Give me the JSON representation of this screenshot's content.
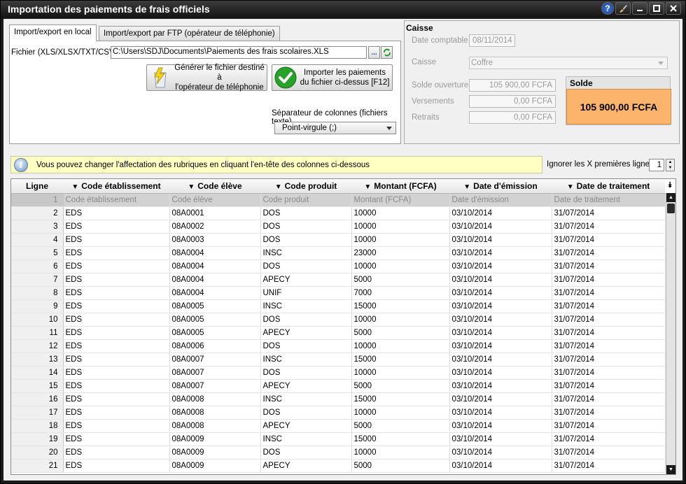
{
  "window": {
    "title": "Importation des paiements de frais officiels",
    "icons": [
      "help-icon",
      "brush-icon",
      "minimize-icon",
      "maximize-icon",
      "close-icon"
    ]
  },
  "tabs": [
    {
      "label": "Import/export en local",
      "active": true
    },
    {
      "label": "Import/export par FTP (opérateur de téléphonie)",
      "active": false
    }
  ],
  "local": {
    "file_label": "Fichier (XLS/XLSX/TXT/CSV)",
    "file_value": "C:\\Users\\SDJ\\Documents\\Paiements des frais scolaires.XLS",
    "browse_label": "...",
    "generate_label": "Générer le fichier destiné à\nl'opérateur de téléphonie",
    "import_label": "Importer les paiements\ndu fichier ci-dessus [F12]",
    "separator_label": "Séparateur de colonnes (fichiers texte)",
    "separator_value": "Point-virgule (;)"
  },
  "caisse": {
    "title": "Caisse",
    "date_label": "Date comptable",
    "date_value": "08/11/2014",
    "caisse_label": "Caisse",
    "caisse_value": "Coffre",
    "solde_ouverture_label": "Solde ouverture",
    "solde_ouverture_value": "105 900,00 FCFA",
    "versements_label": "Versements",
    "versements_value": "0,00 FCFA",
    "retraits_label": "Retraits",
    "retraits_value": "0,00 FCFA",
    "solde_label": "Solde",
    "solde_value": "105 900,00 FCFA",
    "solde_color": "#fcb36b"
  },
  "info": {
    "text": "Vous pouvez changer l'affectation des rubriques en cliquant l'en-tête des colonnes ci-dessous",
    "ignore_label": "Ignorer les X premières lignes",
    "ignore_value": "1"
  },
  "grid": {
    "headers": [
      "Ligne",
      "Code établissement",
      "Code élève",
      "Code produit",
      "Montant (FCFA)",
      "Date d'émission",
      "Date de traitement"
    ],
    "rows": [
      [
        "1",
        "Code établissement",
        "Code élève",
        "Code produit",
        "Montant (FCFA)",
        "Date d'émission",
        "Date de traitement"
      ],
      [
        "2",
        "EDS",
        "08A0001",
        "DOS",
        "10000",
        "03/10/2014",
        "31/07/2014"
      ],
      [
        "3",
        "EDS",
        "08A0002",
        "DOS",
        "10000",
        "03/10/2014",
        "31/07/2014"
      ],
      [
        "4",
        "EDS",
        "08A0003",
        "DOS",
        "10000",
        "03/10/2014",
        "31/07/2014"
      ],
      [
        "5",
        "EDS",
        "08A0004",
        "INSC",
        "23000",
        "03/10/2014",
        "31/07/2014"
      ],
      [
        "6",
        "EDS",
        "08A0004",
        "DOS",
        "10000",
        "03/10/2014",
        "31/07/2014"
      ],
      [
        "7",
        "EDS",
        "08A0004",
        "APECY",
        "5000",
        "03/10/2014",
        "31/07/2014"
      ],
      [
        "8",
        "EDS",
        "08A0004",
        "UNIF",
        "7000",
        "03/10/2014",
        "31/07/2014"
      ],
      [
        "9",
        "EDS",
        "08A0005",
        "INSC",
        "15000",
        "03/10/2014",
        "31/07/2014"
      ],
      [
        "10",
        "EDS",
        "08A0005",
        "DOS",
        "10000",
        "03/10/2014",
        "31/07/2014"
      ],
      [
        "11",
        "EDS",
        "08A0005",
        "APECY",
        "5000",
        "03/10/2014",
        "31/07/2014"
      ],
      [
        "12",
        "EDS",
        "08A0006",
        "DOS",
        "10000",
        "03/10/2014",
        "31/07/2014"
      ],
      [
        "13",
        "EDS",
        "08A0007",
        "INSC",
        "15000",
        "03/10/2014",
        "31/07/2014"
      ],
      [
        "14",
        "EDS",
        "08A0007",
        "DOS",
        "10000",
        "03/10/2014",
        "31/07/2014"
      ],
      [
        "15",
        "EDS",
        "08A0007",
        "APECY",
        "5000",
        "03/10/2014",
        "31/07/2014"
      ],
      [
        "16",
        "EDS",
        "08A0008",
        "INSC",
        "15000",
        "03/10/2014",
        "31/07/2014"
      ],
      [
        "17",
        "EDS",
        "08A0008",
        "DOS",
        "10000",
        "03/10/2014",
        "31/07/2014"
      ],
      [
        "18",
        "EDS",
        "08A0008",
        "APECY",
        "5000",
        "03/10/2014",
        "31/07/2014"
      ],
      [
        "19",
        "EDS",
        "08A0009",
        "INSC",
        "15000",
        "03/10/2014",
        "31/07/2014"
      ],
      [
        "20",
        "EDS",
        "08A0009",
        "DOS",
        "10000",
        "03/10/2014",
        "31/07/2014"
      ],
      [
        "21",
        "EDS",
        "08A0009",
        "APECY",
        "5000",
        "03/10/2014",
        "31/07/2014"
      ]
    ]
  }
}
